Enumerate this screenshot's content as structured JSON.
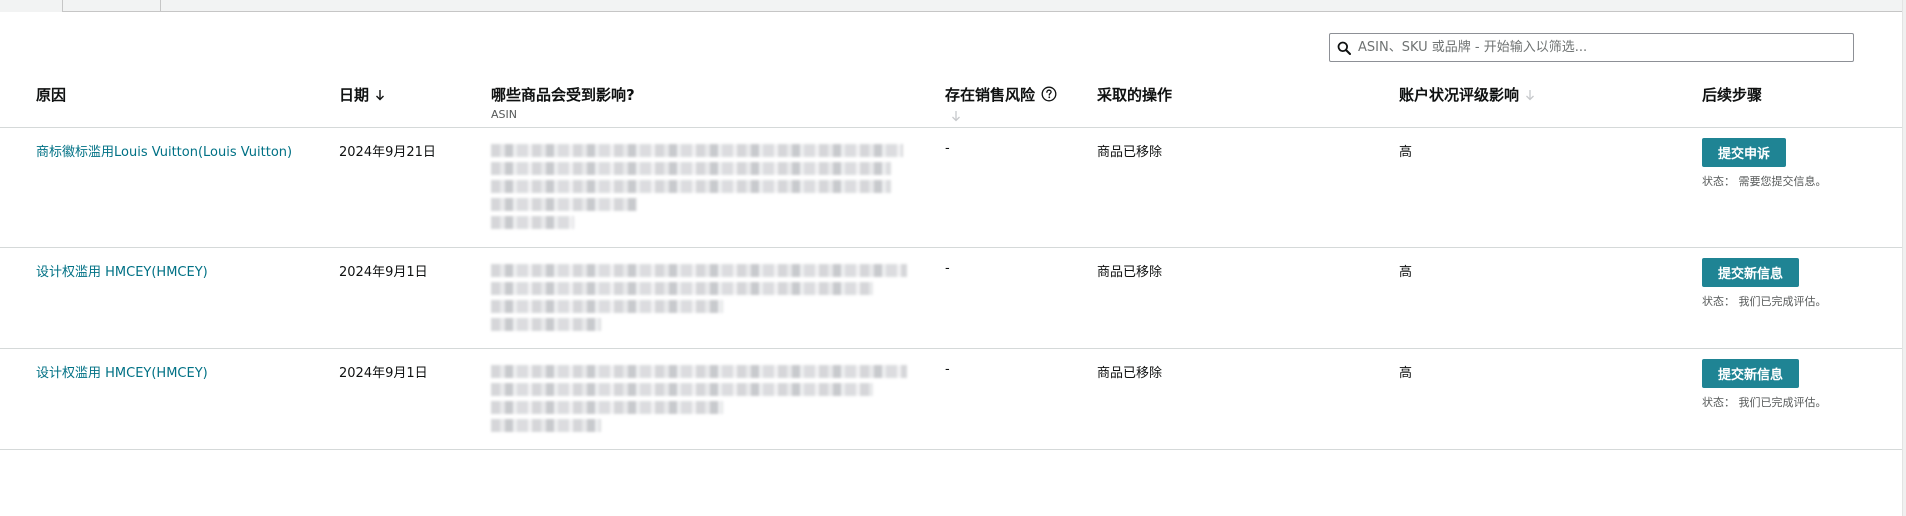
{
  "search": {
    "placeholder": "ASIN、SKU 或品牌 - 开始输入以筛选..."
  },
  "table": {
    "headers": {
      "reason": "原因",
      "date": "日期",
      "products": "哪些商品会受到影响?",
      "products_sub": "ASIN",
      "sales_risk": "存在销售风险",
      "action": "采取的操作",
      "account_impact": "账户状况评级影响",
      "next_steps": "后续步骤"
    },
    "rows": [
      {
        "reason": "商标徽标滥用Louis Vuitton(Louis Vuitton)",
        "date": "2024年9月21日",
        "sales_risk": "-",
        "action": "商品已移除",
        "impact": "高",
        "button": "提交申诉",
        "status": "状态：  需要您提交信息。"
      },
      {
        "reason": "设计权滥用 HMCEY(HMCEY)",
        "date": "2024年9月1日",
        "sales_risk": "-",
        "action": "商品已移除",
        "impact": "高",
        "button": "提交新信息",
        "status": "状态：  我们已完成评估。"
      },
      {
        "reason": "设计权滥用 HMCEY(HMCEY)",
        "date": "2024年9月1日",
        "sales_risk": "-",
        "action": "商品已移除",
        "impact": "高",
        "button": "提交新信息",
        "status": "状态：  我们已完成评估。"
      }
    ]
  },
  "colors": {
    "link": "#007185",
    "button": "#1f8494",
    "border": "#d5d9d9"
  }
}
